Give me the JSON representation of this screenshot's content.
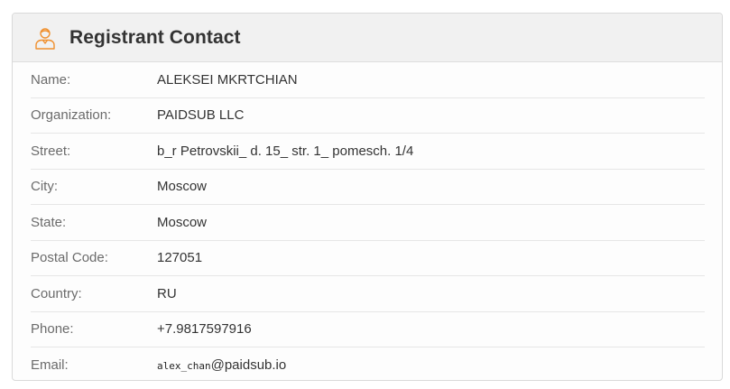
{
  "card": {
    "title": "Registrant Contact",
    "icon": "user-icon",
    "accent_color": "#f0902e"
  },
  "fields": [
    {
      "label": "Name:",
      "value": "ALEKSEI MKRTCHIAN"
    },
    {
      "label": "Organization:",
      "value": "PAIDSUB LLC"
    },
    {
      "label": "Street:",
      "value": "b_r Petrovskii_ d. 15_ str. 1_ pomesch. 1/4"
    },
    {
      "label": "City:",
      "value": "Moscow"
    },
    {
      "label": "State:",
      "value": "Moscow"
    },
    {
      "label": "Postal Code:",
      "value": "127051"
    },
    {
      "label": "Country:",
      "value": "RU"
    },
    {
      "label": "Phone:",
      "value": "+7.9817597916"
    },
    {
      "label": "Email:",
      "email_user": "alex_chan",
      "email_domain": "@paidsub.io"
    }
  ]
}
